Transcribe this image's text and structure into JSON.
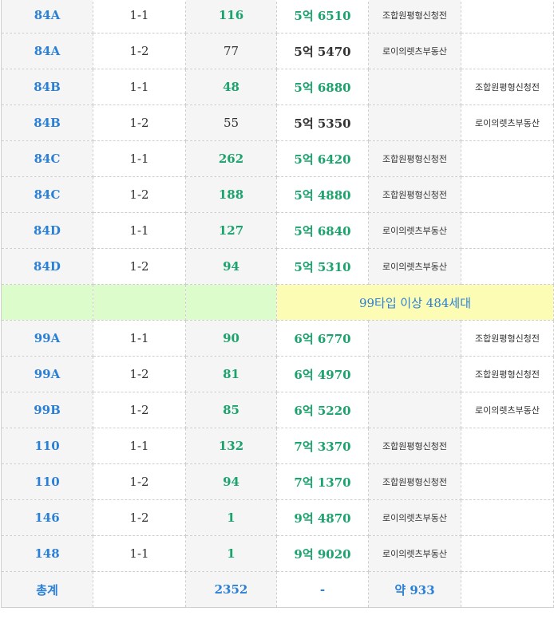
{
  "rows": [
    {
      "type": "84A",
      "round": "1-1",
      "count": "116",
      "count_green": true,
      "price": "5억 6510",
      "price_green": true,
      "note1": "조합원평형신청전",
      "note2": ""
    },
    {
      "type": "84A",
      "round": "1-2",
      "count": "77",
      "count_green": false,
      "price": "5억 5470",
      "price_green": false,
      "note1": "로이의렛츠부동산",
      "note2": ""
    },
    {
      "type": "84B",
      "round": "1-1",
      "count": "48",
      "count_green": true,
      "price": "5억 6880",
      "price_green": true,
      "note1": "",
      "note2": "조합원평형신청전"
    },
    {
      "type": "84B",
      "round": "1-2",
      "count": "55",
      "count_green": false,
      "price": "5억 5350",
      "price_green": false,
      "note1": "",
      "note2": "로이의렛츠부동산"
    },
    {
      "type": "84C",
      "round": "1-1",
      "count": "262",
      "count_green": true,
      "price": "5억 6420",
      "price_green": true,
      "note1": "조합원평형신청전",
      "note2": ""
    },
    {
      "type": "84C",
      "round": "1-2",
      "count": "188",
      "count_green": true,
      "price": "5억 4880",
      "price_green": true,
      "note1": "조합원평형신청전",
      "note2": ""
    },
    {
      "type": "84D",
      "round": "1-1",
      "count": "127",
      "count_green": true,
      "price": "5억 6840",
      "price_green": true,
      "note1": "로이의렛츠부동산",
      "note2": ""
    },
    {
      "type": "84D",
      "round": "1-2",
      "count": "94",
      "count_green": true,
      "price": "5억 5310",
      "price_green": true,
      "note1": "로이의렛츠부동산",
      "note2": ""
    }
  ],
  "section_label": "99타입 이상 484세대",
  "rows2": [
    {
      "type": "99A",
      "round": "1-1",
      "count": "90",
      "price": "6억 6770",
      "note1": "",
      "note2": "조합원평형신청전"
    },
    {
      "type": "99A",
      "round": "1-2",
      "count": "81",
      "price": "6억 4970",
      "note1": "",
      "note2": "조합원평형신청전"
    },
    {
      "type": "99B",
      "round": "1-2",
      "count": "85",
      "price": "6억 5220",
      "note1": "",
      "note2": "로이의렛츠부동산"
    },
    {
      "type": "110",
      "round": "1-1",
      "count": "132",
      "price": "7억 3370",
      "note1": "조합원평형신청전",
      "note2": ""
    },
    {
      "type": "110",
      "round": "1-2",
      "count": "94",
      "price": "7억 1370",
      "note1": "조합원평형신청전",
      "note2": ""
    },
    {
      "type": "146",
      "round": "1-2",
      "count": "1",
      "price": "9억 4870",
      "note1": "로이의렛츠부동산",
      "note2": ""
    },
    {
      "type": "148",
      "round": "1-1",
      "count": "1",
      "price": "9억 9020",
      "note1": "로이의렛츠부동산",
      "note2": ""
    }
  ],
  "total": {
    "label": "총계",
    "count": "2352",
    "price": "-",
    "approx": "약 933"
  },
  "colors": {
    "type_blue": "#2a7fd6",
    "value_green": "#1aa36c",
    "section_green": "#ddfccb",
    "section_yellow": "#fcfcb4"
  }
}
